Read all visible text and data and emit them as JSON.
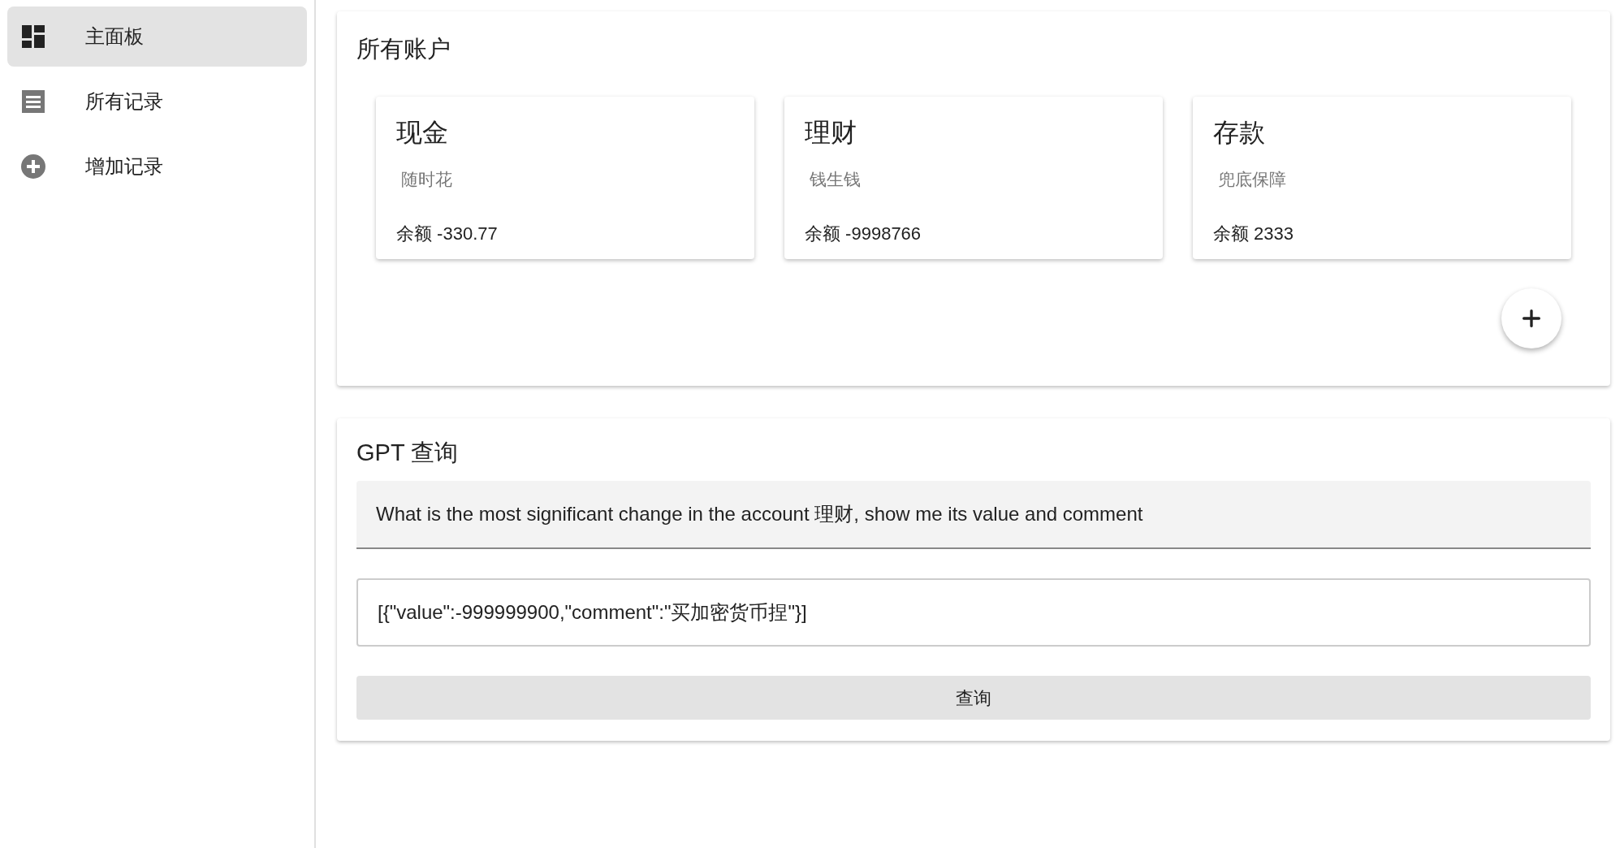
{
  "sidebar": {
    "items": [
      {
        "label": "主面板",
        "kind": "dashboard",
        "selected": true
      },
      {
        "label": "所有记录",
        "kind": "list",
        "selected": false
      },
      {
        "label": "增加记录",
        "kind": "add",
        "selected": false
      }
    ]
  },
  "accounts_panel": {
    "title": "所有账户",
    "accounts": [
      {
        "name": "现金",
        "description": "随时花",
        "balance": "余额 -330.77"
      },
      {
        "name": "理财",
        "description": "钱生钱",
        "balance": "余额 -9998766"
      },
      {
        "name": "存款",
        "description": "兜底保障",
        "balance": "余额 2333"
      }
    ]
  },
  "gpt_panel": {
    "title": "GPT 查询",
    "question": "What is the most significant change in the account 理财, show me its value and comment",
    "answer": "[{\"value\":-999999900,\"comment\":\"买加密货币捏\"}]",
    "button": "查询"
  }
}
